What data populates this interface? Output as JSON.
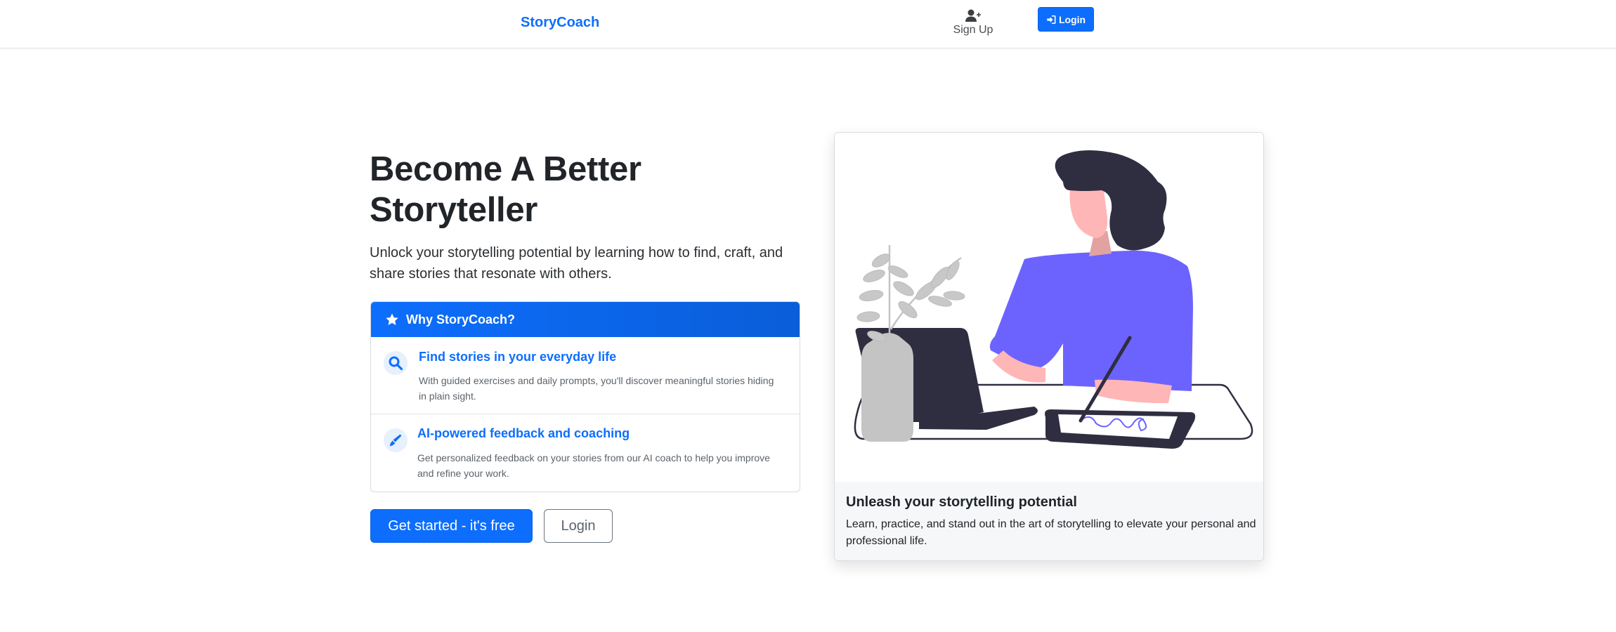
{
  "nav": {
    "brand": "StoryCoach",
    "signup_label": "Sign Up",
    "login_label": "Login",
    "signup_icon": "user-plus-icon",
    "login_icon": "sign-in-icon"
  },
  "hero": {
    "title_line1": "Become A Better",
    "title_line2": "Storyteller",
    "lead": "Unlock your storytelling potential by learning how to find, craft, and share stories that resonate with others."
  },
  "why": {
    "header": "Why StoryCoach?",
    "header_icon": "star-icon",
    "items": [
      {
        "icon": "search-icon",
        "title": "Find stories in your everyday life",
        "text": "With guided exercises and daily prompts, you'll discover meaningful stories hiding in plain sight."
      },
      {
        "icon": "pen-icon",
        "title": "AI-powered feedback and coaching",
        "text": "Get personalized feedback on your stories from our AI coach to help you improve and refine your work."
      }
    ]
  },
  "cta": {
    "primary": "Get started - it's free",
    "secondary": "Login"
  },
  "showcase": {
    "image": "woman-writing-on-tablet-illustration",
    "title": "Unleash your storytelling potential",
    "text": "Learn, practice, and stand out in the art of storytelling to elevate your personal and professional life."
  },
  "colors": {
    "primary": "#0d6efd",
    "shirt": "#6c63ff",
    "hair": "#2f2e41",
    "skin": "#ffb6b6"
  }
}
